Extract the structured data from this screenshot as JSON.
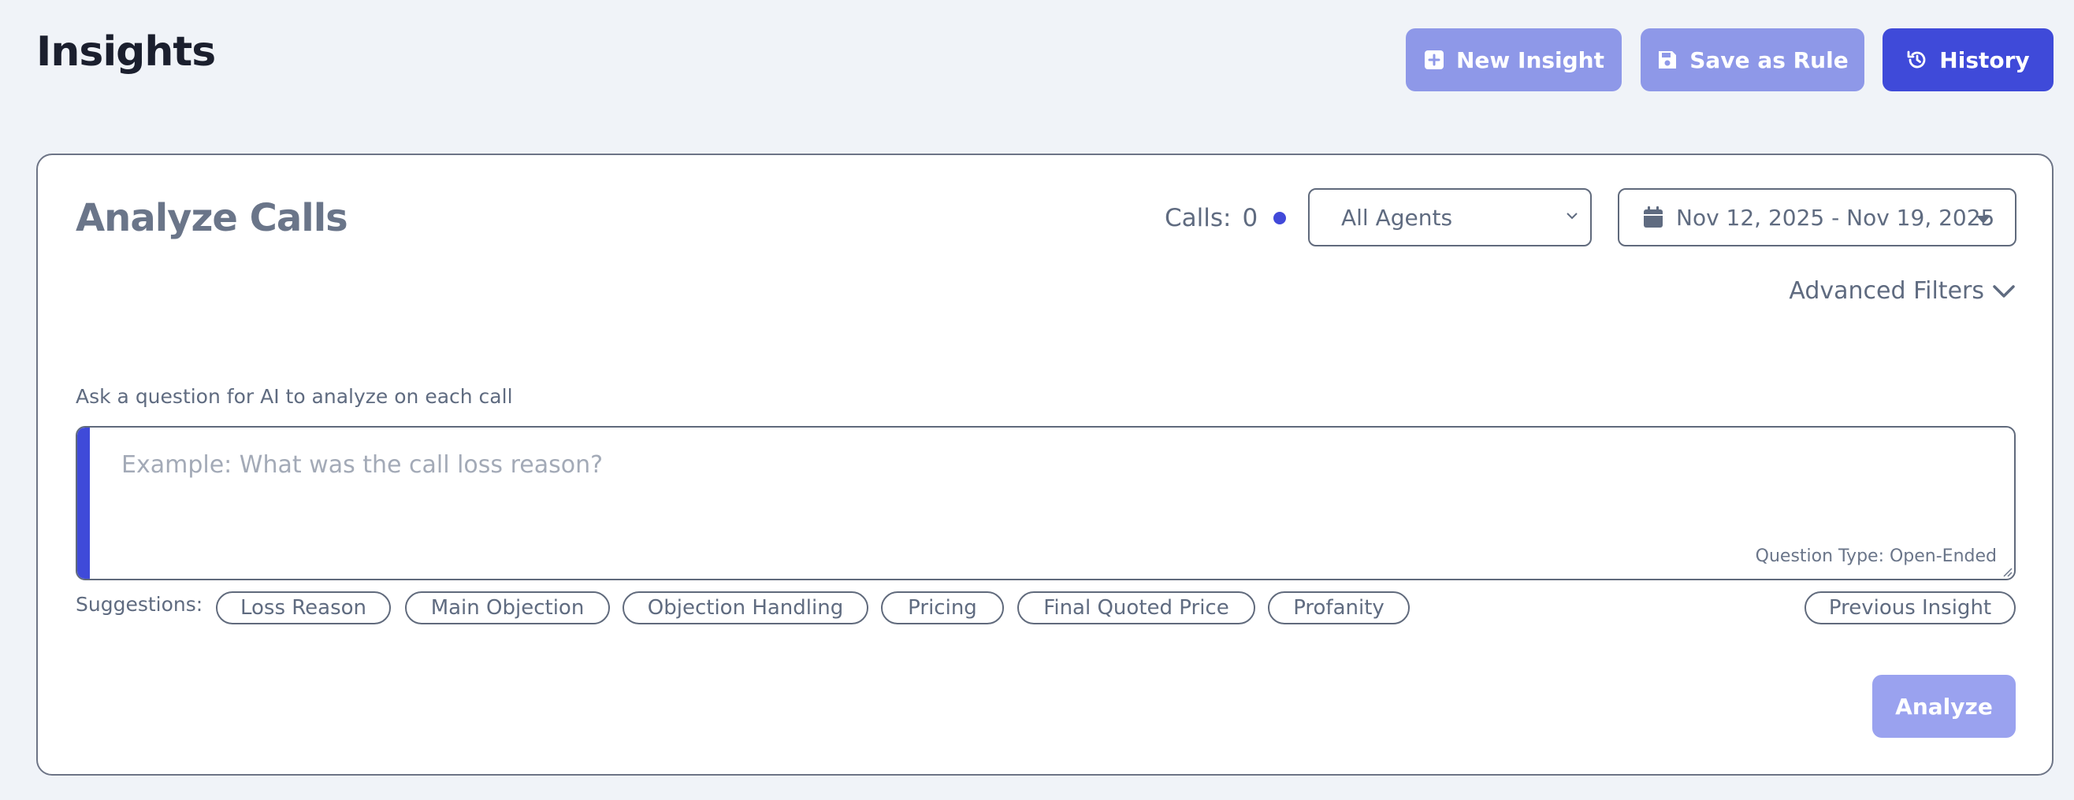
{
  "header": {
    "title": "Insights",
    "buttons": {
      "new_insight": "New Insight",
      "save_as_rule": "Save as Rule",
      "history": "History"
    }
  },
  "analyze": {
    "title": "Analyze Calls",
    "calls_label": "Calls:",
    "calls_count": "0",
    "agent_select": "All Agents",
    "date_range": "Nov 12, 2025 - Nov 19, 2025",
    "advanced_filters": "Advanced Filters",
    "ask_label": "Ask a question for AI to analyze on each call",
    "question_placeholder": "Example: What was the call loss reason?",
    "question_value": "",
    "question_type": "Question Type: Open-Ended",
    "suggestions_label": "Suggestions:",
    "suggestions": [
      "Loss Reason",
      "Main Objection",
      "Objection Handling",
      "Pricing",
      "Final Quoted Price",
      "Profanity"
    ],
    "previous_insight": "Previous Insight",
    "analyze_button": "Analyze"
  },
  "colors": {
    "background": "#f0f3f8",
    "primary": "#3f4ad9",
    "primary_light": "#8e98e8",
    "primary_disabled": "#9aa2ef",
    "text_muted": "#5f6b80"
  },
  "icons": {
    "new_insight": "plus-square-icon",
    "save_as_rule": "floppy-disk-icon",
    "history": "history-icon",
    "agent_select": "chevron-down-icon",
    "date_range": "calendar-icon",
    "date_caret": "caret-down-icon",
    "advanced_filters": "chevron-down-icon"
  }
}
